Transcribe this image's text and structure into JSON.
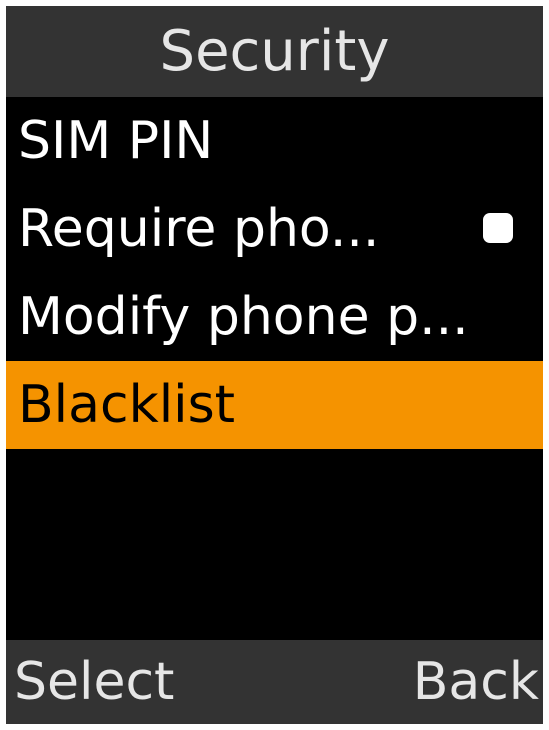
{
  "header": {
    "title": "Security"
  },
  "menu": {
    "items": [
      {
        "label": "SIM PIN",
        "selected": false
      },
      {
        "label": "Require pho...",
        "selected": false,
        "toggle": {
          "checked": false
        }
      },
      {
        "label": "Modify phone p...",
        "selected": false
      },
      {
        "label": "Blacklist",
        "selected": true
      }
    ]
  },
  "softkeys": {
    "left_label": "Select",
    "right_label": "Back"
  },
  "colors": {
    "header_bg": "#333333",
    "list_bg": "#000000",
    "highlight": "#f59300",
    "text": "#ffffff"
  }
}
